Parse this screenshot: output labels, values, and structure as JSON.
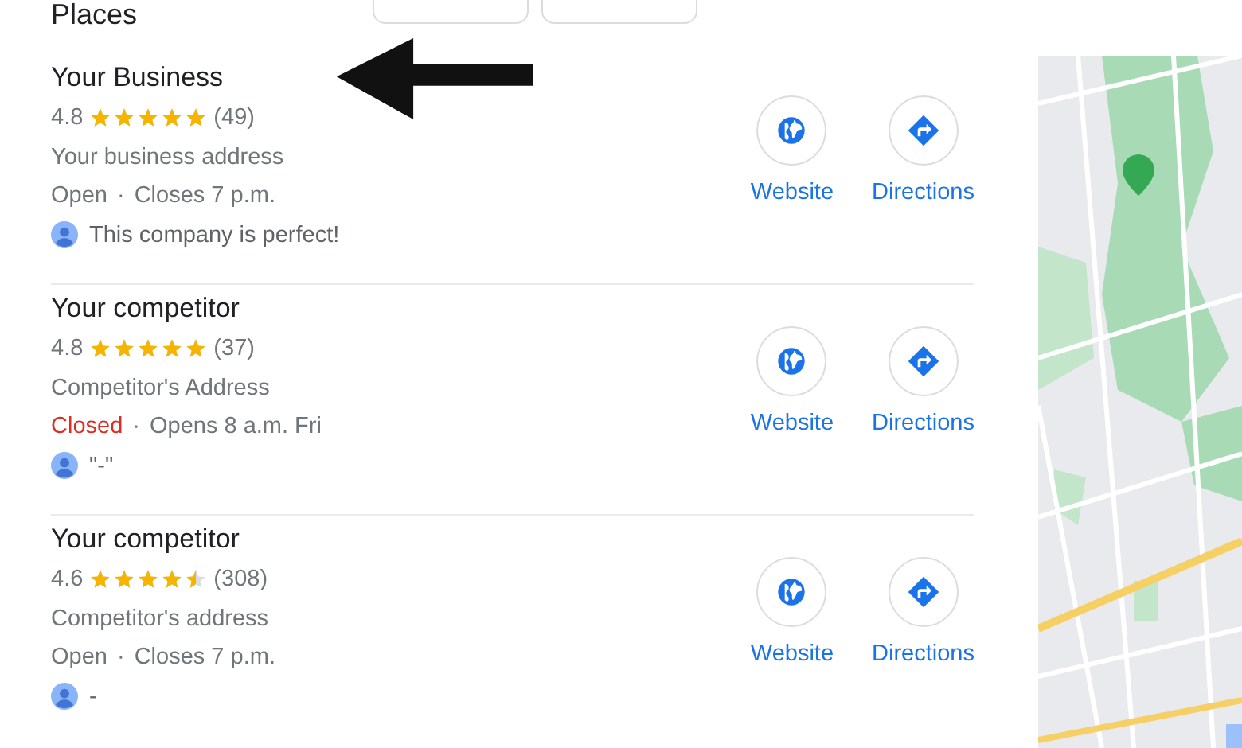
{
  "heading": "Places",
  "places": [
    {
      "name": "Your Business",
      "rating": "4.8",
      "stars": 5,
      "reviews": "(49)",
      "address": "Your business address",
      "status": "Open",
      "open": true,
      "separator": "·",
      "hours": "Closes 7 p.m.",
      "review": "This company is perfect!",
      "website": "Website",
      "directions": "Directions"
    },
    {
      "name": "Your competitor",
      "rating": "4.8",
      "stars": 5,
      "reviews": "(37)",
      "address": "Competitor's Address",
      "status": "Closed",
      "open": false,
      "separator": "·",
      "hours": "Opens 8 a.m. Fri",
      "review": "\"-\"",
      "website": "Website",
      "directions": "Directions"
    },
    {
      "name": "Your competitor",
      "rating": "4.6",
      "stars": 4.5,
      "reviews": "(308)",
      "address": "Competitor's address",
      "status": "Open",
      "open": true,
      "separator": "·",
      "hours": "Closes 7 p.m.",
      "review": "-",
      "website": "Website",
      "directions": "Directions"
    }
  ]
}
